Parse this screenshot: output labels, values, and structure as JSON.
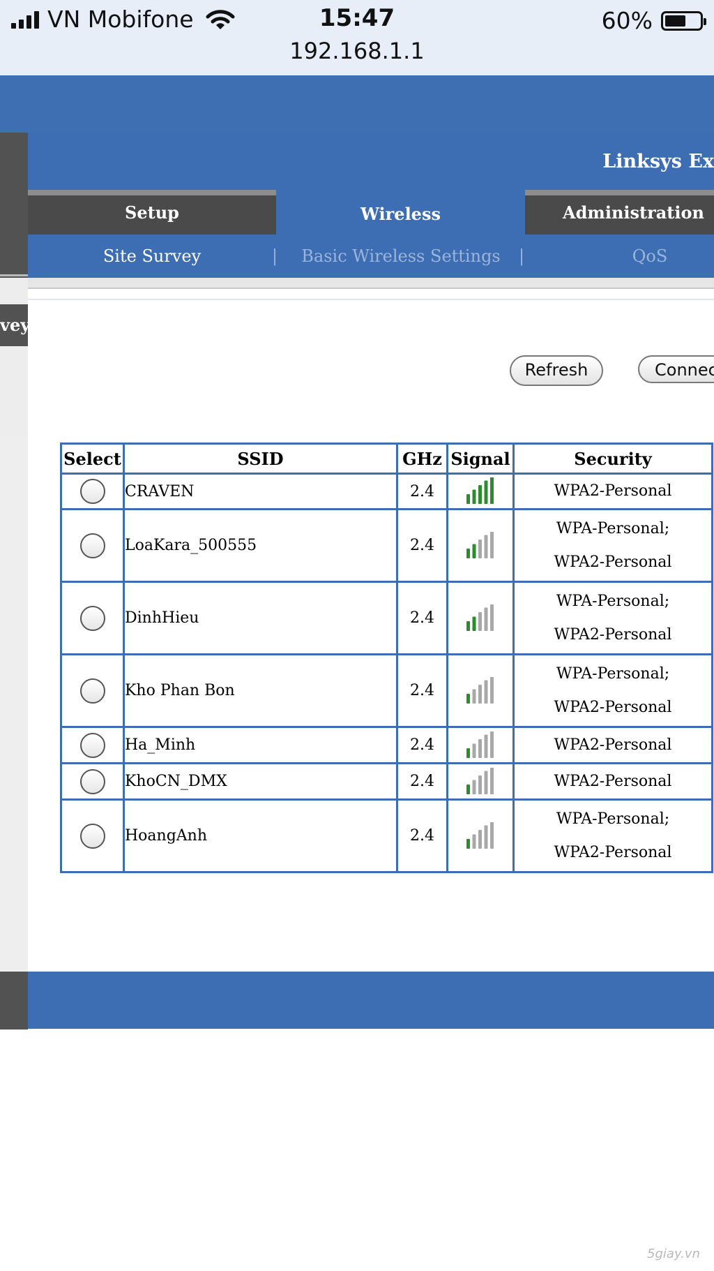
{
  "status_bar": {
    "carrier": "VN Mobifone",
    "time": "15:47",
    "url": "192.168.1.1",
    "battery_percent": "60%",
    "battery_level": 0.6
  },
  "header": {
    "product_title": "Linksys Ex"
  },
  "tabs": [
    {
      "label": "Setup"
    },
    {
      "label": "Wireless"
    },
    {
      "label": "Administration"
    }
  ],
  "subnav": {
    "items": [
      {
        "label": "Site Survey"
      },
      {
        "label": "Basic Wireless Settings"
      },
      {
        "label": "QoS"
      }
    ],
    "separator": "|"
  },
  "left_rail": {
    "section_label": "vey"
  },
  "actions": {
    "refresh_label": "Refresh",
    "connect_label": "Connect"
  },
  "table": {
    "headers": [
      "Select",
      "SSID",
      "GHz",
      "Signal",
      "Security"
    ],
    "rows": [
      {
        "ssid": "CRAVEN",
        "ghz": "2.4",
        "signal_bars": 5,
        "security": [
          "WPA2-Personal"
        ]
      },
      {
        "ssid": "LoaKara_500555",
        "ghz": "2.4",
        "signal_bars": 2,
        "security": [
          "WPA-Personal;",
          "WPA2-Personal"
        ]
      },
      {
        "ssid": "DinhHieu",
        "ghz": "2.4",
        "signal_bars": 2,
        "security": [
          "WPA-Personal;",
          "WPA2-Personal"
        ]
      },
      {
        "ssid": "Kho Phan Bon",
        "ghz": "2.4",
        "signal_bars": 1,
        "security": [
          "WPA-Personal;",
          "WPA2-Personal"
        ]
      },
      {
        "ssid": "Ha_Minh",
        "ghz": "2.4",
        "signal_bars": 1,
        "security": [
          "WPA2-Personal"
        ]
      },
      {
        "ssid": "KhoCN_DMX",
        "ghz": "2.4",
        "signal_bars": 1,
        "security": [
          "WPA2-Personal"
        ]
      },
      {
        "ssid": "HoangAnh",
        "ghz": "2.4",
        "signal_bars": 1,
        "security": [
          "WPA-Personal;",
          "WPA2-Personal"
        ]
      }
    ]
  },
  "colors": {
    "brand_blue": "#3d6eb4",
    "signal_active": "#2e8b2e",
    "signal_inactive": "#a8a8a8"
  },
  "watermark": "5giay.vn"
}
